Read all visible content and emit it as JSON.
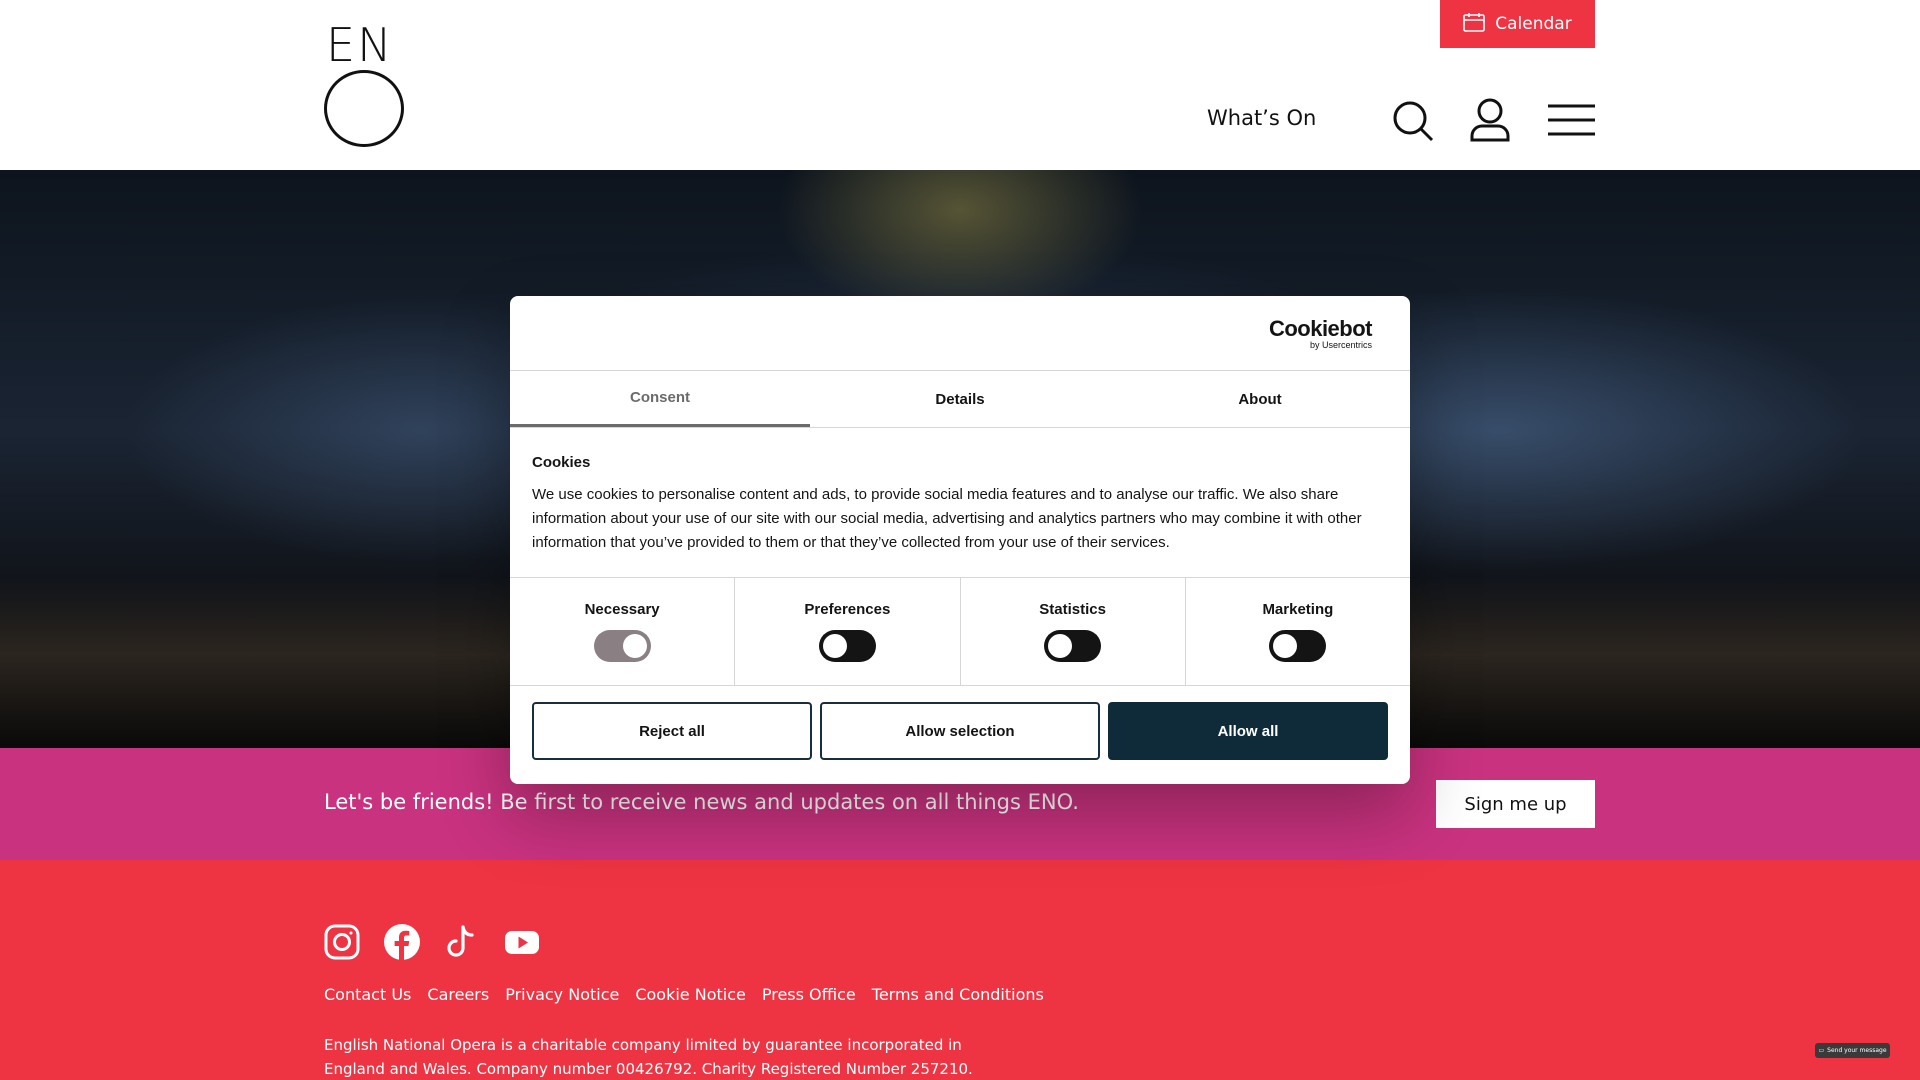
{
  "header": {
    "logo_text": "EN",
    "calendar_label": "Calendar",
    "nav_whats_on": "What’s On"
  },
  "newsletter": {
    "text": "Let's be friends! Be first to receive news and updates on all things ENO.",
    "signup_label": "Sign me up"
  },
  "footer": {
    "social": [
      "instagram-icon",
      "facebook-icon",
      "tiktok-icon",
      "youtube-icon"
    ],
    "links": [
      "Contact Us",
      "Careers",
      "Privacy Notice",
      "Cookie Notice",
      "Press Office",
      "Terms and Conditions"
    ],
    "legal": "English National Opera is a charitable company limited by guarantee incorporated in England and Wales. Company number 00426792. Charity Registered Number 257210."
  },
  "cookie_dialog": {
    "brand": "Cookiebot",
    "brand_sub": "by Usercentrics",
    "tabs": [
      "Consent",
      "Details",
      "About"
    ],
    "active_tab": "Consent",
    "title": "Cookies",
    "body": "We use cookies to personalise content and ads, to provide social media features and to analyse our traffic. We also share information about your use of our site with our social media, advertising and analytics partners who may combine it with other information that you’ve provided to them or that they’ve collected from your use of their services.",
    "switches": [
      {
        "label": "Necessary",
        "state": "on-disabled"
      },
      {
        "label": "Preferences",
        "state": "off"
      },
      {
        "label": "Statistics",
        "state": "off"
      },
      {
        "label": "Marketing",
        "state": "off"
      }
    ],
    "buttons": {
      "reject": "Reject all",
      "allow_selection": "Allow selection",
      "allow_all": "Allow all"
    }
  },
  "chat_widget": {
    "label": "Send your message"
  },
  "colors": {
    "brand_red": "#ee3443",
    "newsletter_pink": "#c9327f",
    "cookie_primary": "#0f2b3a"
  }
}
